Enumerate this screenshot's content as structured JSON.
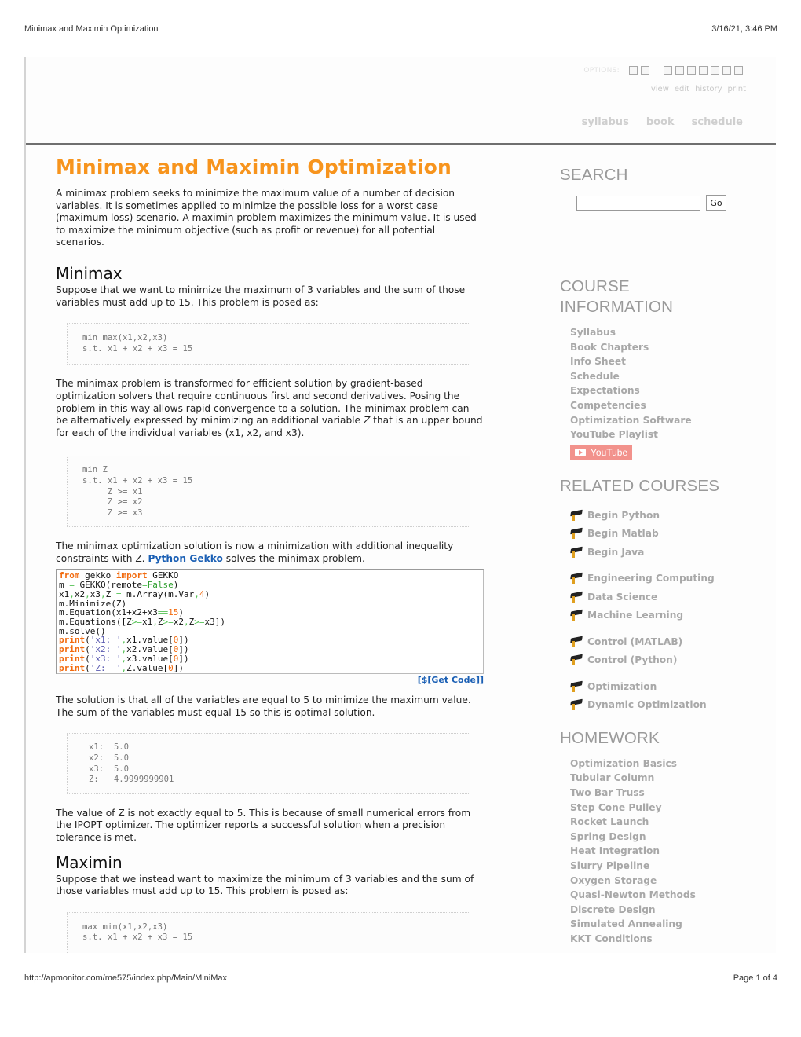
{
  "print_header": {
    "title": "Minimax and Maximin Optimization",
    "datetime": "3/16/21, 3:46 PM"
  },
  "print_footer": {
    "url": "http://apmonitor.com/me575/index.php/Main/MiniMax",
    "page": "Page 1 of 4"
  },
  "top_bar": {
    "options_label": "OPTIONS:",
    "option_links": [
      "view",
      "edit",
      "history",
      "print"
    ],
    "nav": [
      "syllabus",
      "book",
      "schedule"
    ]
  },
  "main": {
    "title": "Minimax and Maximin Optimization",
    "intro": "A minimax problem seeks to minimize the maximum value of a number of decision variables. It is sometimes applied to minimize the possible loss for a worst case (maximum loss) scenario. A maximin problem maximizes the minimum value. It is used to maximize the minimum objective (such as profit or revenue) for all potential scenarios.",
    "minimax_heading": "Minimax",
    "minimax_p1": "Suppose that we want to minimize the maximum of 3 variables and the sum of those variables must add up to 15. This problem is posed as:",
    "minimax_formulation": "min max(x1,x2,x3)\ns.t. x1 + x2 + x3 = 15",
    "minimax_p2_a": "The minimax problem is transformed for efficient solution by gradient-based optimization solvers that require continuous first and second derivatives. Posing the problem in this way allows rapid convergence to a solution. The minimax problem can be alternatively expressed by minimizing an additional variable ",
    "minimax_p2_z": "Z",
    "minimax_p2_b": " that is an upper bound for each of the individual variables (x1, x2, and x3).",
    "minimax_reformulation": "min Z\ns.t. x1 + x2 + x3 = 15\n     Z >= x1\n     Z >= x2\n     Z >= x3",
    "minimax_p3_a": "The minimax optimization solution is now a minimization with additional inequality constraints with Z. ",
    "minimax_p3_link": "Python Gekko",
    "minimax_p3_b": " solves the minimax problem.",
    "code_lines": [
      "from gekko import GEKKO",
      "m = GEKKO(remote=False)",
      "x1,x2,x3,Z = m.Array(m.Var,4)",
      "m.Minimize(Z)",
      "m.Equation(x1+x2+x3==15)",
      "m.Equations([Z>=x1,Z>=x2,Z>=x3])",
      "m.solve()",
      "print('x1: ',x1.value[0])",
      "print('x2: ',x2.value[0])",
      "print('x3: ',x3.value[0])",
      "print('Z:  ',Z.value[0])"
    ],
    "get_code": "[$[Get Code]]",
    "solution_p": "The solution is that all of the variables are equal to 5 to minimize the maximum value. The sum of the variables must equal 15 so this is optimal solution.",
    "solution_output": "x1:  5.0\nx2:  5.0\nx3:  5.0\nZ:   4.9999999901",
    "z_note": "The value of Z is not exactly equal to 5. This is because of small numerical errors from the IPOPT optimizer. The optimizer reports a successful solution when a precision tolerance is met.",
    "maximin_heading": "Maximin",
    "maximin_p1": "Suppose that we instead want to maximize the minimum of 3 variables and the sum of those variables must add up to 15. This problem is posed as:",
    "maximin_formulation": "max min(x1,x2,x3)\ns.t. x1 + x2 + x3 = 15"
  },
  "sidebar": {
    "search_heading": "SEARCH",
    "search_value": "",
    "go_label": "Go",
    "course_info_heading_1": "COURSE",
    "course_info_heading_2": "INFORMATION",
    "course_info": [
      "Syllabus",
      "Book Chapters",
      "Info Sheet",
      "Schedule",
      "Expectations",
      "Competencies",
      "Optimization Software",
      "YouTube Playlist"
    ],
    "youtube_label": "YouTube",
    "related_heading": "RELATED COURSES",
    "related_groups": [
      [
        "Begin Python",
        "Begin Matlab",
        "Begin Java"
      ],
      [
        "Engineering Computing",
        "Data Science",
        "Machine Learning"
      ],
      [
        "Control (MATLAB)",
        "Control (Python)"
      ],
      [
        "Optimization",
        "Dynamic Optimization"
      ]
    ],
    "homework_heading": "HOMEWORK",
    "homework": [
      "Optimization Basics",
      "Tubular Column",
      "Two Bar Truss",
      "Step Cone Pulley",
      "Rocket Launch",
      "Spring Design",
      "Heat Integration",
      "Slurry Pipeline",
      "Oxygen Storage",
      "Quasi-Newton Methods",
      "Discrete Design",
      "Simulated Annealing",
      "KKT Conditions"
    ]
  },
  "colors": {
    "title": "#f7941d",
    "link": "#1a5fb4",
    "sidebar_text": "#a8a8a8",
    "youtube": "#f2928c"
  }
}
